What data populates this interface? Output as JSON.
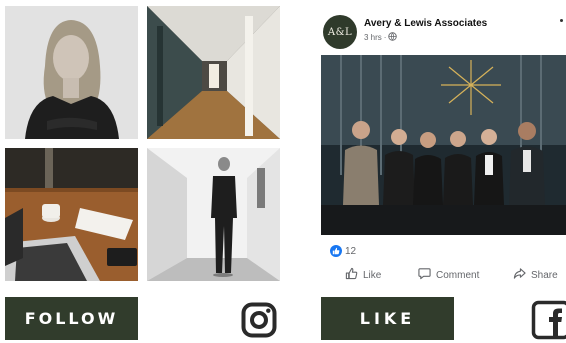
{
  "icons": {
    "instagram": "instagram-icon",
    "facebook": "facebook-icon",
    "globe": "globe-icon",
    "like_badge": "thumbs-up-icon",
    "like": "thumbs-up-icon",
    "comment": "comment-icon",
    "share": "share-icon",
    "more": "more-options-icon"
  },
  "colors": {
    "brand_green": "#313c2c",
    "facebook_blue": "#1877f2",
    "meta_gray": "#65676b"
  },
  "left_panel": {
    "follow_label": "FOLLOW"
  },
  "post": {
    "avatar_initials": "A&L",
    "page_name": "Avery & Lewis Associates",
    "time": "3 hrs",
    "separator": "·",
    "reaction_count": "12",
    "actions": {
      "like": "Like",
      "comment": "Comment",
      "share": "Share"
    }
  },
  "right_panel": {
    "like_label": "LIKE"
  }
}
